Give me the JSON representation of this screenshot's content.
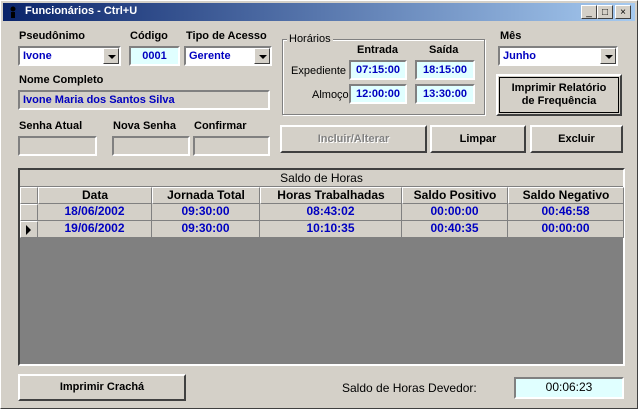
{
  "window": {
    "title": "Funcionários - Ctrl+U"
  },
  "form": {
    "pseudonimo_label": "Pseudônimo",
    "pseudonimo_value": "Ivone",
    "codigo_label": "Código",
    "codigo_value": "0001",
    "tipo_acesso_label": "Tipo de Acesso",
    "tipo_acesso_value": "Gerente",
    "nome_completo_label": "Nome Completo",
    "nome_completo_value": "Ivone Maria dos Santos Silva",
    "senha_atual_label": "Senha Atual",
    "nova_senha_label": "Nova Senha",
    "confirmar_label": "Confirmar"
  },
  "horarios": {
    "group_label": "Horários",
    "entrada_label": "Entrada",
    "saida_label": "Saída",
    "expediente_label": "Expediente",
    "almoco_label": "Almoço",
    "expediente_entrada": "07:15:00",
    "expediente_saida": "18:15:00",
    "almoco_entrada": "12:00:00",
    "almoco_saida": "13:30:00"
  },
  "mes": {
    "label": "Mês",
    "value": "Junho"
  },
  "buttons": {
    "imprimir_relatorio": "Imprimir Relatório de Frequência",
    "incluir_alterar": "Incluir/Alterar",
    "limpar": "Limpar",
    "excluir": "Excluir",
    "imprimir_cracha": "Imprimir Crachá"
  },
  "grid": {
    "caption": "Saldo de Horas",
    "columns": [
      "Data",
      "Jornada Total",
      "Horas Trabalhadas",
      "Saldo Positivo",
      "Saldo Negativo"
    ],
    "rows": [
      [
        "18/06/2002",
        "09:30:00",
        "08:43:02",
        "00:00:00",
        "00:46:58"
      ],
      [
        "19/06/2002",
        "09:30:00",
        "10:10:35",
        "00:40:35",
        "00:00:00"
      ]
    ],
    "current_row": 1
  },
  "saldo_devedor": {
    "label": "Saldo de Horas Devedor:",
    "value": "00:06:23"
  },
  "colors": {
    "title_start": "#0a246a",
    "title_end": "#a6caf0",
    "value_text": "#0000c0",
    "highlight_field": "#e0ffff"
  }
}
